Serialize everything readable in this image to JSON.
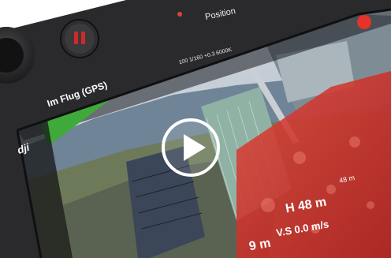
{
  "status_bar": {
    "flight_mode": "Im Flug (GPS)",
    "position_label": "Position",
    "camera_readout": "100 1/160 +0.3 6000K"
  },
  "brand": {
    "logo_text": "dji"
  },
  "telemetry": {
    "altitude": "48 m",
    "height": "H 48 m",
    "vertical_speed": "V.S 0.0 m/s",
    "distance": "9 m"
  },
  "video": {
    "play_overlay": "play-icon"
  },
  "colors": {
    "flight_mode_bar": "#3faa3a",
    "controller_body": "#2b2b2d",
    "pause_button": "#cf2a2a"
  }
}
